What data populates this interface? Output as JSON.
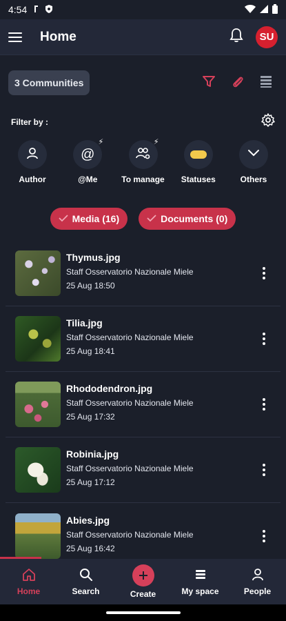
{
  "status_bar": {
    "time": "4:54"
  },
  "header": {
    "title": "Home",
    "avatar_initials": "SU"
  },
  "toolbar": {
    "communities_label": "3 Communities"
  },
  "filter": {
    "label": "Filter by :",
    "chips": [
      {
        "label": "Author",
        "icon": "person-icon"
      },
      {
        "label": "@Me",
        "icon": "at-icon"
      },
      {
        "label": "To manage",
        "icon": "people-gear-icon"
      },
      {
        "label": "Statuses",
        "icon": "status-pill-icon"
      },
      {
        "label": "Others",
        "icon": "chevron-down-icon"
      }
    ]
  },
  "tabs": {
    "media_label": "Media (16)",
    "documents_label": "Documents (0)"
  },
  "items": [
    {
      "title": "Thymus.jpg",
      "author": "Staff Osservatorio Nazionale Miele",
      "date": "25 Aug 18:50"
    },
    {
      "title": "Tilia.jpg",
      "author": "Staff Osservatorio Nazionale Miele",
      "date": "25 Aug 18:41"
    },
    {
      "title": "Rhododendron.jpg",
      "author": "Staff Osservatorio Nazionale Miele",
      "date": "25 Aug 17:32"
    },
    {
      "title": "Robinia.jpg",
      "author": "Staff Osservatorio Nazionale Miele",
      "date": "25 Aug 17:12"
    },
    {
      "title": "Abies.jpg",
      "author": "Staff Osservatorio Nazionale Miele",
      "date": "25 Aug 16:42"
    }
  ],
  "nav": {
    "home": "Home",
    "search": "Search",
    "create": "Create",
    "myspace": "My space",
    "people": "People"
  },
  "colors": {
    "accent": "#c8324a",
    "background": "#1b1f2a",
    "bar": "#232838"
  }
}
